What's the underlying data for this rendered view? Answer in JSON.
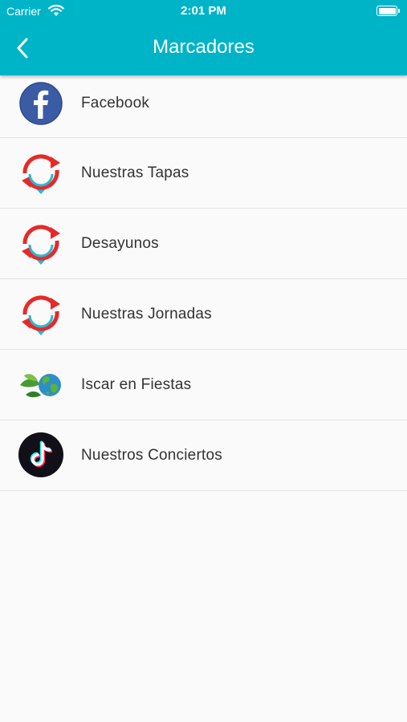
{
  "status_bar": {
    "carrier": "Carrier",
    "time": "2:01 PM"
  },
  "nav": {
    "title": "Marcadores",
    "back_icon": "chevron-left-icon"
  },
  "colors": {
    "header": "#00b4c8",
    "arrow_red": "#e52a2a",
    "arrow_cyan": "#29b9d3"
  },
  "items": [
    {
      "label": "Facebook",
      "icon": "facebook-icon"
    },
    {
      "label": "Nuestras Tapas",
      "icon": "refresh-pin-icon"
    },
    {
      "label": "Desayunos",
      "icon": "refresh-pin-icon"
    },
    {
      "label": "Nuestras Jornadas",
      "icon": "refresh-pin-icon"
    },
    {
      "label": "Iscar en Fiestas",
      "icon": "leaf-globe-icon"
    },
    {
      "label": "Nuestros Conciertos",
      "icon": "tiktok-icon"
    }
  ]
}
